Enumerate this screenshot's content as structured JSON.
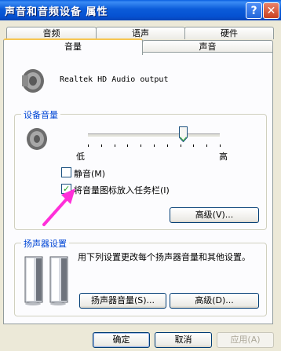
{
  "window": {
    "title": "声音和音频设备 属性",
    "help_glyph": "?",
    "close_glyph": "✕"
  },
  "tabs": {
    "top_row": [
      "音频",
      "语声",
      "硬件"
    ],
    "bottom_row": [
      "音量",
      "声音"
    ],
    "active": "音量"
  },
  "device": {
    "name": "Realtek HD Audio output",
    "icon": "speaker-icon"
  },
  "device_volume": {
    "group_title": "设备音量",
    "slider_low_label": "低",
    "slider_high_label": "高",
    "slider_level": 0.72,
    "mute_label": "静音(M)",
    "mute_checked": false,
    "tray_label": "将音量图标放入任务栏(I)",
    "tray_checked": true,
    "advanced_button": "高级(V)..."
  },
  "speaker_settings": {
    "group_title": "扬声器设置",
    "description": "用下列设置更改每个扬声器音量和其他设置。",
    "icon": "speakers-icon",
    "speaker_volume_button": "扬声器音量(S)...",
    "advanced_button": "高级(D)..."
  },
  "footer": {
    "ok": "确定",
    "cancel": "取消",
    "apply": "应用(A)"
  },
  "colors": {
    "title_bar": "#0A5FE0",
    "group_title": "#0046D5",
    "annotation_arrow": "#FF2FD9"
  }
}
